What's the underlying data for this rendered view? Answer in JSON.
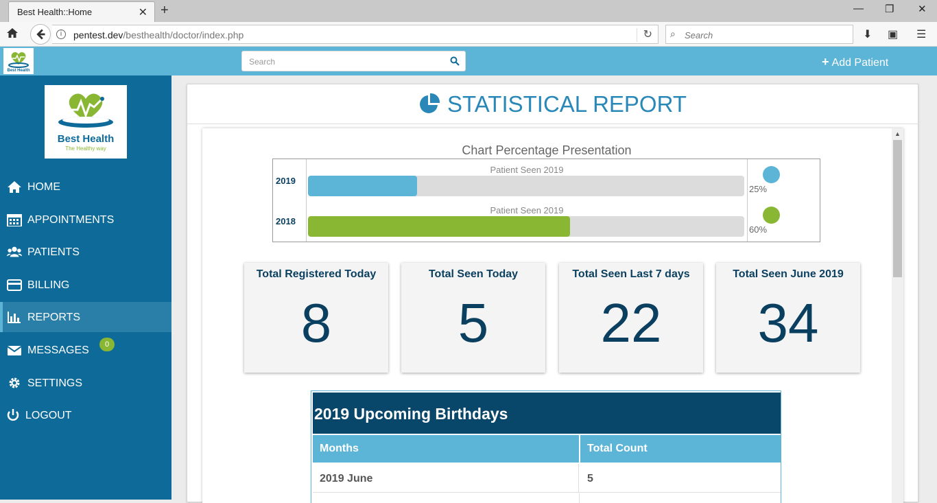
{
  "browser": {
    "tab_title": "Best Health::Home",
    "url_host": "pentest.dev",
    "url_path": "/besthealth/doctor/index.php",
    "search_placeholder": "Search"
  },
  "appbar": {
    "search_placeholder": "Search",
    "add_patient_label": "Add Patient",
    "add_patient_icon": "plus-icon"
  },
  "brand": {
    "name": "Best Health",
    "tagline": "The Healthy way",
    "colors": {
      "primary": "#0e6a99",
      "accent": "#5cb5d6",
      "green": "#8ab733",
      "dark": "#08476a"
    }
  },
  "sidebar": {
    "items": [
      {
        "label": "HOME",
        "icon": "home-icon"
      },
      {
        "label": "APPOINTMENTS",
        "icon": "calendar-icon"
      },
      {
        "label": "PATIENTS",
        "icon": "users-icon"
      },
      {
        "label": "BILLING",
        "icon": "credit-card-icon"
      },
      {
        "label": "REPORTS",
        "icon": "bar-chart-icon",
        "active": true
      },
      {
        "label": "MESSAGES",
        "icon": "envelope-icon",
        "badge": "0"
      },
      {
        "label": "SETTINGS",
        "icon": "gear-icon"
      },
      {
        "label": "LOGOUT",
        "icon": "power-icon"
      }
    ]
  },
  "main": {
    "title": "STATISTICAL REPORT",
    "title_icon": "pie-chart-icon"
  },
  "chart_data": {
    "type": "bar",
    "title": "Chart Percentage Presentation",
    "categories": [
      "2019",
      "2018"
    ],
    "captions": [
      "Patient Seen 2019",
      "Patient Seen 2019"
    ],
    "values": [
      25,
      60
    ],
    "labels": [
      "25%",
      "60%"
    ],
    "colors": [
      "#5cb5d6",
      "#8ab733"
    ],
    "ylim": [
      0,
      100
    ]
  },
  "stats": [
    {
      "label": "Total Registered Today",
      "value": "8"
    },
    {
      "label": "Total Seen Today",
      "value": "5"
    },
    {
      "label": "Total Seen Last 7 days",
      "value": "22"
    },
    {
      "label": "Total Seen June 2019",
      "value": "34"
    }
  ],
  "birthdays": {
    "title": "2019 Upcoming Birthdays",
    "columns": [
      "Months",
      "Total Count"
    ],
    "rows": [
      [
        "2019 June",
        "5"
      ]
    ]
  }
}
